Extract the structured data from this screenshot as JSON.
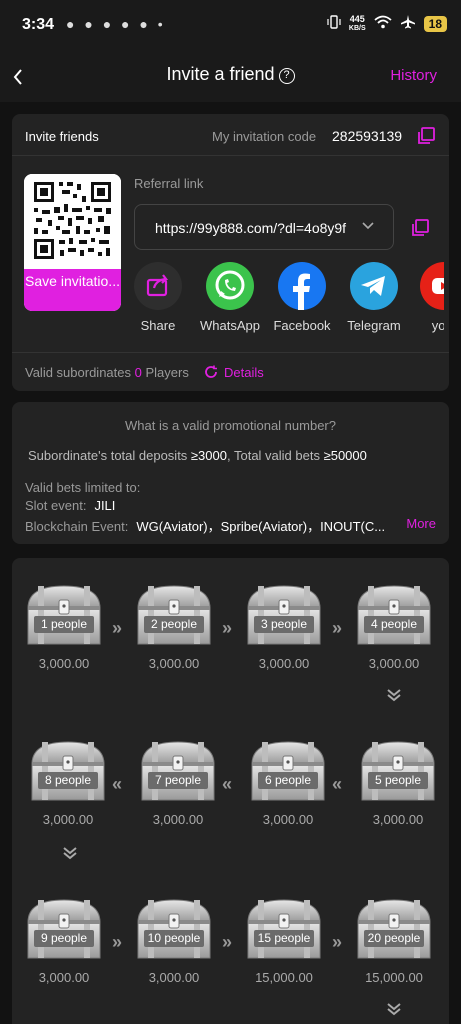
{
  "status": {
    "time": "3:34",
    "left_icons": "● ● ● ● ● •",
    "speed_top": "445",
    "speed_bottom": "KB/S",
    "battery": "18"
  },
  "header": {
    "title": "Invite a friend",
    "help_glyph": "?",
    "history_label": "History"
  },
  "invite": {
    "title": "Invite friends",
    "code_label": "My invitation code",
    "code_value": "282593139",
    "save_label": "Save invitatio...",
    "referral_label": "Referral link",
    "referral_url": "https://99y888.com/?dl=4o8y9f",
    "share_items": [
      {
        "label": "Share",
        "icon": "share-icon",
        "color": "#2e2e2e"
      },
      {
        "label": "WhatsApp",
        "icon": "whatsapp-icon",
        "color": "#3bc34c"
      },
      {
        "label": "Facebook",
        "icon": "facebook-icon",
        "color": "#1877f2"
      },
      {
        "label": "Telegram",
        "icon": "telegram-icon",
        "color": "#2aa3de"
      },
      {
        "label": "yout",
        "icon": "youtube-icon",
        "color": "#e62117"
      }
    ],
    "subordinates_label": "Valid subordinates",
    "subordinates_count": "0",
    "subordinates_unit": "Players",
    "details_label": "Details"
  },
  "rules": {
    "title": "What is a valid promotional number?",
    "line_prefix": "Subordinate's total deposits ",
    "deposits": "≥3000",
    "line_middle": ", Total valid bets ",
    "bets": "≥50000",
    "valid_label": "Valid bets limited to:",
    "slot_label": "Slot event:",
    "slot_value": "JILI",
    "chain_label": "Blockchain Event:",
    "chain_value": "WG(Aviator)，Spribe(Aviator)，INOUT(C...",
    "more_label": "More"
  },
  "rewards": {
    "rows": [
      [
        {
          "people": "1 people",
          "amount": "3,000.00"
        },
        {
          "people": "2 people",
          "amount": "3,000.00"
        },
        {
          "people": "3 people",
          "amount": "3,000.00"
        },
        {
          "people": "4 people",
          "amount": "3,000.00"
        }
      ],
      [
        {
          "people": "8 people",
          "amount": "3,000.00"
        },
        {
          "people": "7 people",
          "amount": "3,000.00"
        },
        {
          "people": "6 people",
          "amount": "3,000.00"
        },
        {
          "people": "5 people",
          "amount": "3,000.00"
        }
      ],
      [
        {
          "people": "9 people",
          "amount": "3,000.00"
        },
        {
          "people": "10 people",
          "amount": "3,000.00"
        },
        {
          "people": "15 people",
          "amount": "15,000.00"
        },
        {
          "people": "20 people",
          "amount": "15,000.00"
        }
      ]
    ],
    "arrow_right": "»",
    "arrow_left": "«"
  },
  "accent_color": "#e020e0"
}
